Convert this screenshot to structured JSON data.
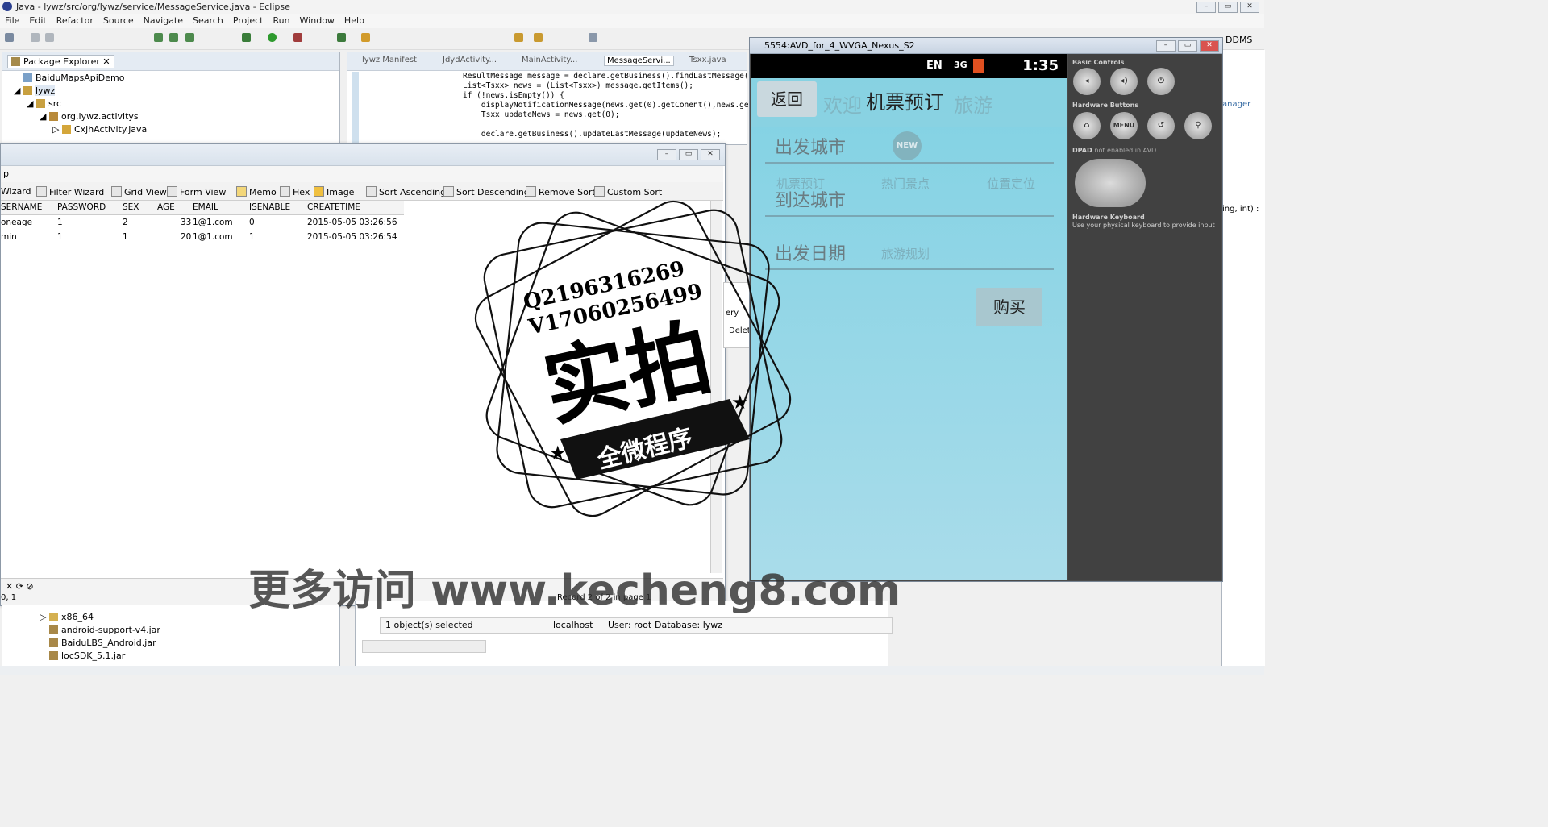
{
  "window": {
    "title": "Java - lywz/src/org/lywz/service/MessageService.java - Eclipse"
  },
  "menu": [
    "File",
    "Edit",
    "Refactor",
    "Source",
    "Navigate",
    "Search",
    "Project",
    "Run",
    "Window",
    "Help"
  ],
  "package_explorer": {
    "tab": "Package Explorer",
    "items": [
      "BaiduMapsApiDemo",
      "lywz",
      "src",
      "org.lywz.activitys",
      "CxjhActivity.java"
    ]
  },
  "editor": {
    "tabs": [
      "lywz Manifest",
      "JdydActivity...",
      "MainActivity...",
      "MessageServi...",
      "Tsxx.java"
    ],
    "code": [
      "ResultMessage message = declare.getBusiness().findLastMessage(",
      "List<Tsxx> news = (List<Tsxx>) message.getItems();",
      "if (!news.isEmpty()) {",
      "    displayNotificationMessage(news.get(0).getConent(),news.ge",
      "    Tsxx updateNews = news.get(0);",
      "",
      "    declare.getBusiness().updateLastMessage(updateNews);"
    ]
  },
  "db": {
    "menu_fragment": "lp",
    "toolbar": [
      "Wizard",
      "Filter Wizard",
      "Grid View",
      "Form View",
      "Memo",
      "Hex",
      "Image",
      "Sort Ascending",
      "Sort Descending",
      "Remove Sort",
      "Custom Sort"
    ],
    "columns": [
      "SERNAME",
      "PASSWORD",
      "SEX",
      "AGE",
      "EMAIL",
      "ISENABLE",
      "CREATETIME"
    ],
    "rows": [
      [
        "oneage",
        "1",
        "2",
        "33",
        "1@1.com",
        "0",
        "2015-05-05 03:26:56"
      ],
      [
        "min",
        "1",
        "1",
        "20",
        "1@1.com",
        "1",
        "2015-05-05 03:26:54"
      ]
    ],
    "record_pos": "0, 1",
    "record_info": "Record 2 of 2 in page 1",
    "side_labels": [
      "ery",
      "Delet"
    ]
  },
  "bottom": {
    "tree": [
      "x86_64",
      "android-support-v4.jar",
      "BaiduLBS_Android.jar",
      "locSDK_5.1.jar"
    ],
    "status": "1 object(s) selected",
    "connection": "localhost",
    "user": "User: root",
    "database": "Database: lywz"
  },
  "emulator": {
    "title": "5554:AVD_for_4_WVGA_Nexus_S2",
    "status": {
      "lang": "EN",
      "net": "3G",
      "time": "1:35"
    },
    "back": "返回",
    "app_title": "机票预订",
    "bg_title": "欢迎",
    "bg_title2": "旅游",
    "fields": [
      "出发城市",
      "到达城市",
      "出发日期"
    ],
    "ghost_items": [
      "机票预订",
      "热门景点",
      "位置定位",
      "旅游规划"
    ],
    "new_badge": "NEW",
    "buy": "购买",
    "controls": {
      "basic": "Basic Controls",
      "hardware": "Hardware Buttons",
      "menu": "MENU",
      "dpad_main": "DPAD",
      "dpad_note": "not enabled in AVD",
      "keyboard": "Hardware Keyboard",
      "keyboard_note": "Use your physical keyboard to provide input"
    }
  },
  "right_strip": {
    "ddms": "DDMS",
    "frag1": "anager",
    "frag2": "ing, int) :"
  },
  "overlay": {
    "qq": "Q2196316269",
    "wx": "V17060256499",
    "big": "实拍",
    "ribbon": "全微程序",
    "site": "更多访问 www.kecheng8.com"
  }
}
